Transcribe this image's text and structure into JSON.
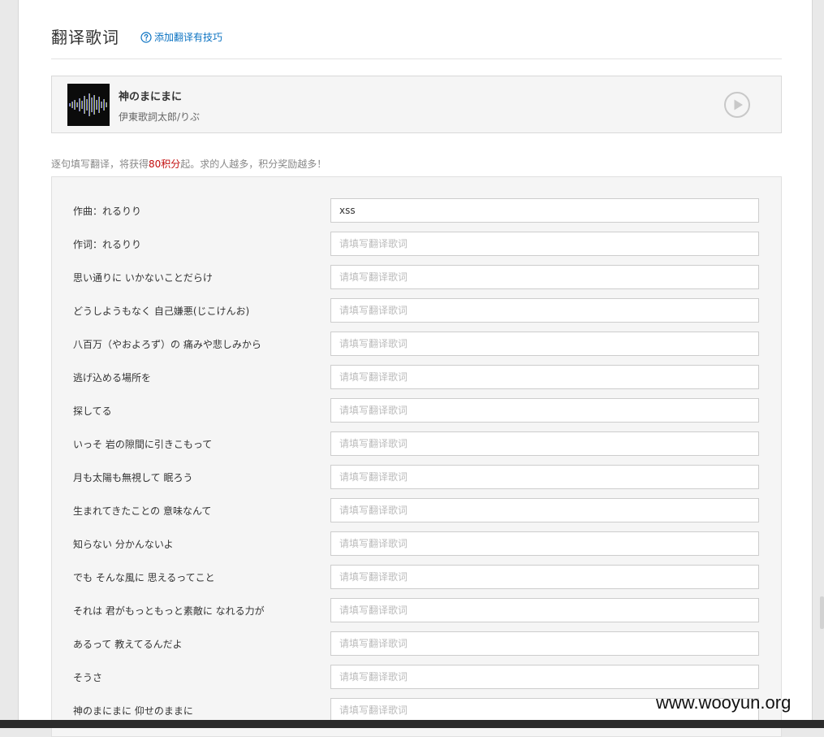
{
  "header": {
    "title": "翻译歌词",
    "help_link": "添加翻译有技巧"
  },
  "song": {
    "title": "神のまにまに",
    "artist": "伊東歌詞太郎/りぶ"
  },
  "reward_tip": {
    "prefix": "逐句填写翻译，将获得",
    "points": "80积分",
    "suffix": "起。求的人越多，积分奖励越多！"
  },
  "translation_placeholder": "请填写翻译歌词",
  "lines": [
    {
      "original": "作曲：れるりり",
      "translation": "xss"
    },
    {
      "original": "作词：れるりり",
      "translation": ""
    },
    {
      "original": "思い通りに いかないことだらけ",
      "translation": ""
    },
    {
      "original": "どうしようもなく 自己嫌悪(じこけんお)",
      "translation": ""
    },
    {
      "original": "八百万（やおよろず）の 痛みや悲しみから",
      "translation": ""
    },
    {
      "original": "逃げ込める場所を",
      "translation": ""
    },
    {
      "original": "探してる",
      "translation": ""
    },
    {
      "original": "いっそ 岩の隙間に引きこもって",
      "translation": ""
    },
    {
      "original": "月も太陽も無視して 眠ろう",
      "translation": ""
    },
    {
      "original": "生まれてきたことの 意味なんて",
      "translation": ""
    },
    {
      "original": "知らない 分かんないよ",
      "translation": ""
    },
    {
      "original": "でも そんな風に 思えるってこと",
      "translation": ""
    },
    {
      "original": "それは 君がもっともっと素敵に なれる力が",
      "translation": ""
    },
    {
      "original": "あるって 教えてるんだよ",
      "translation": ""
    },
    {
      "original": "そうさ",
      "translation": ""
    },
    {
      "original": "神のまにまに 仰せのままに",
      "translation": ""
    }
  ],
  "watermark": "www.wooyun.org",
  "colors": {
    "link": "#0c73c2",
    "points": "#c20c0c",
    "panel_bg": "#f5f5f5"
  },
  "icons": {
    "help": "question-circle-icon",
    "play": "play-circle-icon"
  }
}
